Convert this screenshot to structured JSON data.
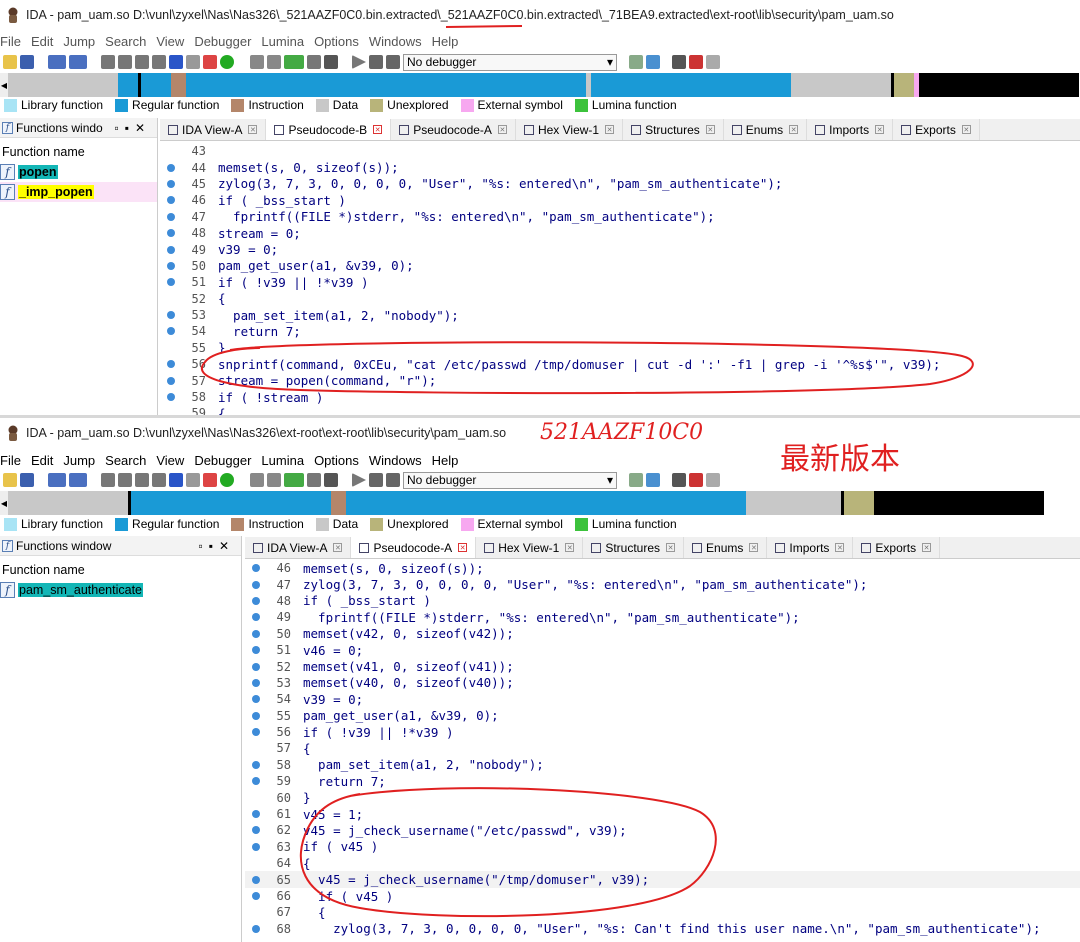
{
  "top": {
    "title": "IDA - pam_uam.so D:\\vunl\\zyxel\\Nas\\Nas326\\_521AAZF0C0.bin.extracted\\_521AAZF0C0.bin.extracted\\_71BEA9.extracted\\ext-root\\lib\\security\\pam_uam.so",
    "menu": [
      "File",
      "Edit",
      "Jump",
      "Search",
      "View",
      "Debugger",
      "Lumina",
      "Options",
      "Windows",
      "Help"
    ],
    "debugger": "No debugger",
    "legend": [
      {
        "label": "Library function",
        "color": "#a8e4f5"
      },
      {
        "label": "Regular function",
        "color": "#1a9ad6"
      },
      {
        "label": "Instruction",
        "color": "#b4866a"
      },
      {
        "label": "Data",
        "color": "#c8c8c8"
      },
      {
        "label": "Unexplored",
        "color": "#b8b47a"
      },
      {
        "label": "External symbol",
        "color": "#f7a8f0"
      },
      {
        "label": "Lumina function",
        "color": "#3cc23c"
      }
    ],
    "functions_title": "Functions windo",
    "functions_column": "Function name",
    "functions": [
      {
        "name": "popen",
        "bg": "#13b6b6"
      },
      {
        "name": "_imp_popen",
        "bg": "#ffff00"
      }
    ],
    "tabs": [
      "IDA View-A",
      "Pseudocode-B",
      "Pseudocode-A",
      "Hex View-1",
      "Structures",
      "Enums",
      "Imports",
      "Exports"
    ],
    "active_tab": 1,
    "code": [
      {
        "n": "43",
        "t": ""
      },
      {
        "n": "44",
        "t": "memset(s, 0, sizeof(s));"
      },
      {
        "n": "45",
        "t": "zylog(3, 7, 3, 0, 0, 0, 0, \"User\", \"%s: entered\\n\", \"pam_sm_authenticate\");"
      },
      {
        "n": "46",
        "t": "if ( _bss_start )"
      },
      {
        "n": "47",
        "t": "  fprintf((FILE *)stderr, \"%s: entered\\n\", \"pam_sm_authenticate\");"
      },
      {
        "n": "48",
        "t": "stream = 0;"
      },
      {
        "n": "49",
        "t": "v39 = 0;"
      },
      {
        "n": "50",
        "t": "pam_get_user(a1, &v39, 0);"
      },
      {
        "n": "51",
        "t": "if ( !v39 || !*v39 )"
      },
      {
        "n": "52",
        "t": "{"
      },
      {
        "n": "53",
        "t": "  pam_set_item(a1, 2, \"nobody\");"
      },
      {
        "n": "54",
        "t": "  return 7;"
      },
      {
        "n": "55",
        "t": "}"
      },
      {
        "n": "56",
        "t": "snprintf(command, 0xCEu, \"cat /etc/passwd /tmp/domuser | cut -d ':' -f1 | grep -i '^%s$'\", v39);"
      },
      {
        "n": "57",
        "t": "stream = popen(command, \"r\");"
      },
      {
        "n": "58",
        "t": "if ( !stream )"
      },
      {
        "n": "59",
        "t": "{"
      }
    ]
  },
  "bottom": {
    "title": "IDA - pam_uam.so D:\\vunl\\zyxel\\Nas\\Nas326\\ext-root\\ext-root\\lib\\security\\pam_uam.so",
    "menu": [
      "File",
      "Edit",
      "Jump",
      "Search",
      "View",
      "Debugger",
      "Lumina",
      "Options",
      "Windows",
      "Help"
    ],
    "debugger": "No debugger",
    "legend": [
      {
        "label": "Library function",
        "color": "#a8e4f5"
      },
      {
        "label": "Regular function",
        "color": "#1a9ad6"
      },
      {
        "label": "Instruction",
        "color": "#b4866a"
      },
      {
        "label": "Data",
        "color": "#c8c8c8"
      },
      {
        "label": "Unexplored",
        "color": "#b8b47a"
      },
      {
        "label": "External symbol",
        "color": "#f7a8f0"
      },
      {
        "label": "Lumina function",
        "color": "#3cc23c"
      }
    ],
    "functions_title": "Functions window",
    "functions_column": "Function name",
    "functions": [
      {
        "name": "pam_sm_authenticate",
        "bg": "#13b6b6"
      }
    ],
    "tabs": [
      "IDA View-A",
      "Pseudocode-A",
      "Hex View-1",
      "Structures",
      "Enums",
      "Imports",
      "Exports"
    ],
    "active_tab": 1,
    "code": [
      {
        "n": "46",
        "t": "memset(s, 0, sizeof(s));"
      },
      {
        "n": "47",
        "t": "zylog(3, 7, 3, 0, 0, 0, 0, \"User\", \"%s: entered\\n\", \"pam_sm_authenticate\");"
      },
      {
        "n": "48",
        "t": "if ( _bss_start )"
      },
      {
        "n": "49",
        "t": "  fprintf((FILE *)stderr, \"%s: entered\\n\", \"pam_sm_authenticate\");"
      },
      {
        "n": "50",
        "t": "memset(v42, 0, sizeof(v42));"
      },
      {
        "n": "51",
        "t": "v46 = 0;"
      },
      {
        "n": "52",
        "t": "memset(v41, 0, sizeof(v41));"
      },
      {
        "n": "53",
        "t": "memset(v40, 0, sizeof(v40));"
      },
      {
        "n": "54",
        "t": "v39 = 0;"
      },
      {
        "n": "55",
        "t": "pam_get_user(a1, &v39, 0);"
      },
      {
        "n": "56",
        "t": "if ( !v39 || !*v39 )"
      },
      {
        "n": "57",
        "t": "{"
      },
      {
        "n": "58",
        "t": "  pam_set_item(a1, 2, \"nobody\");"
      },
      {
        "n": "59",
        "t": "  return 7;"
      },
      {
        "n": "60",
        "t": "}"
      },
      {
        "n": "61",
        "t": "v45 = 1;"
      },
      {
        "n": "62",
        "t": "v45 = j_check_username(\"/etc/passwd\", v39);"
      },
      {
        "n": "63",
        "t": "if ( v45 )"
      },
      {
        "n": "64",
        "t": "{"
      },
      {
        "n": "65",
        "t": "  v45 = j_check_username(\"/tmp/domuser\", v39);"
      },
      {
        "n": "66",
        "t": "  if ( v45 )"
      },
      {
        "n": "67",
        "t": "  {"
      },
      {
        "n": "68",
        "t": "    zylog(3, 7, 3, 0, 0, 0, 0, \"User\", \"%s: Can't find this user name.\\n\", \"pam_sm_authenticate\");"
      }
    ]
  },
  "annotations": {
    "version_label": "521AAZF10C0",
    "newest_label": "最新版本",
    "ink_color": "#e02020"
  }
}
